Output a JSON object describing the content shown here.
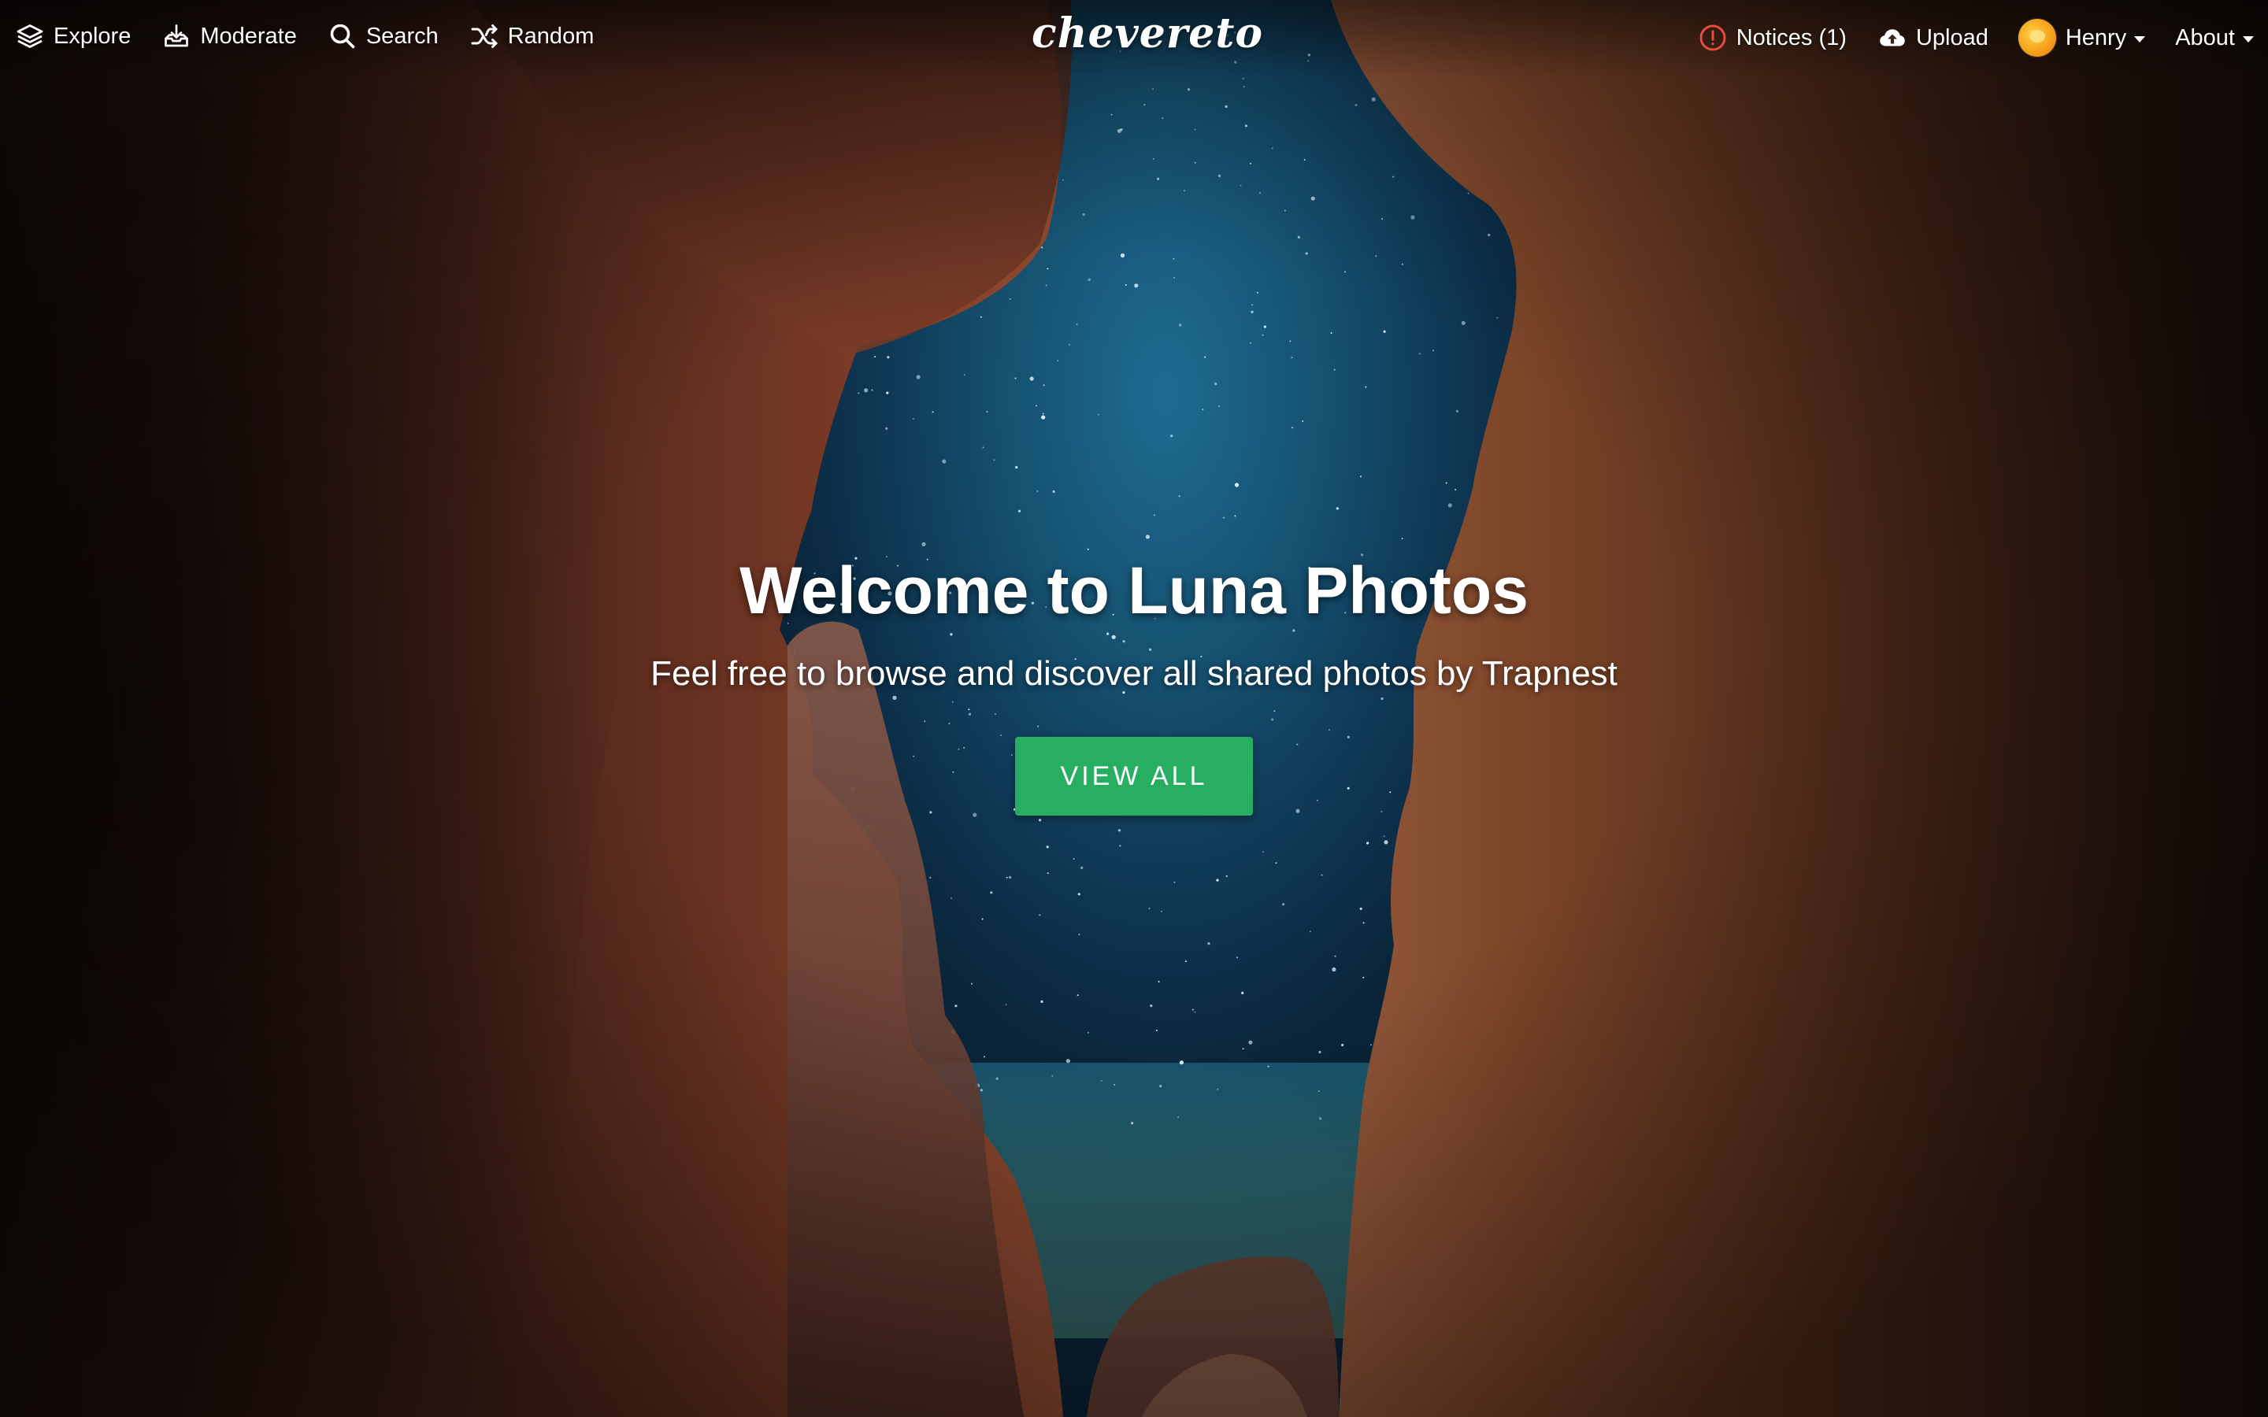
{
  "nav": {
    "left": [
      {
        "label": "Explore",
        "icon": "layers-icon"
      },
      {
        "label": "Moderate",
        "icon": "inbox-download-icon"
      },
      {
        "label": "Search",
        "icon": "search-icon"
      },
      {
        "label": "Random",
        "icon": "shuffle-icon"
      }
    ],
    "brand": "chevereto",
    "right": {
      "notices": {
        "label": "Notices (1)",
        "icon": "alert-circle-icon",
        "icon_color": "#e74c3c"
      },
      "upload": {
        "label": "Upload",
        "icon": "cloud-upload-icon"
      },
      "user": {
        "label": "Henry",
        "icon": "avatar"
      },
      "about": {
        "label": "About"
      }
    }
  },
  "hero": {
    "title": "Welcome to Luna Photos",
    "subtitle": "Feel free to browse and discover all shared photos by Trapnest",
    "button_label": "VIEW ALL"
  },
  "colors": {
    "accent_green": "#27ae60",
    "text": "#ffffff"
  }
}
